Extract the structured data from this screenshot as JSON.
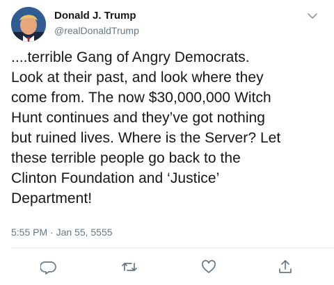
{
  "user": {
    "display_name": "Donald J. Trump",
    "handle": "@realDonaldTrump"
  },
  "tweet": {
    "text": "....terrible Gang of Angry Democrats.\nLook at their past, and look where they\ncome from. The now $30,000,000 Witch\nHunt continues and they’ve got nothing\nbut ruined lives. Where is the Server? Let\nthese terrible people go back to the\nClinton Foundation and ‘Justice’\nDepartment!",
    "timestamp": "5:55 PM · Jan 55, 5555"
  },
  "icons": {
    "menu": "chevron-down-icon",
    "reply": "reply-icon",
    "retweet": "retweet-icon",
    "like": "like-icon",
    "share": "share-icon"
  },
  "colors": {
    "text": "#14171a",
    "secondary": "#657786",
    "divider": "#e1e8ed"
  }
}
